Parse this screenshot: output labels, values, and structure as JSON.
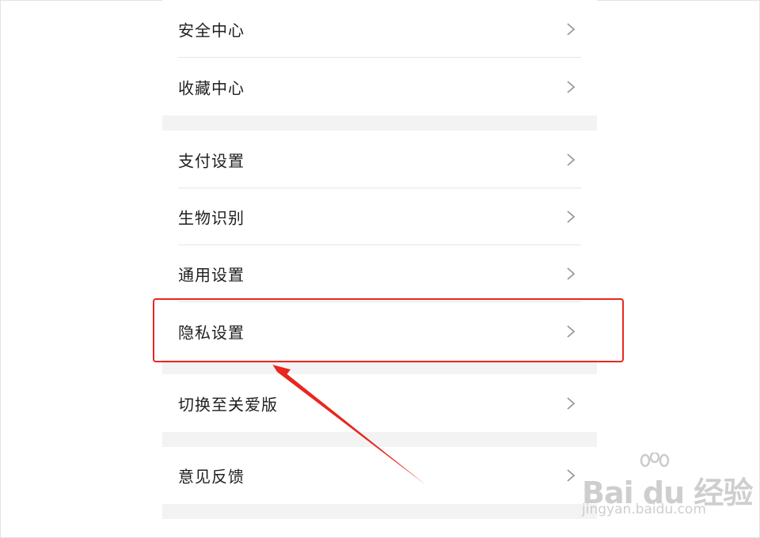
{
  "settings": {
    "items": [
      {
        "label": "安全中心"
      },
      {
        "label": "收藏中心"
      },
      {
        "label": "支付设置"
      },
      {
        "label": "生物识别"
      },
      {
        "label": "通用设置"
      },
      {
        "label": "隐私设置"
      },
      {
        "label": "切换至关爱版"
      },
      {
        "label": "意见反馈"
      }
    ],
    "chevron_icon": "chevron-right-icon"
  },
  "annotation": {
    "highlighted_item": "隐私设置",
    "highlight_color": "#e8271f"
  },
  "watermark": {
    "brand": "Bai du 经验",
    "url": "jingyan.baidu.com"
  }
}
